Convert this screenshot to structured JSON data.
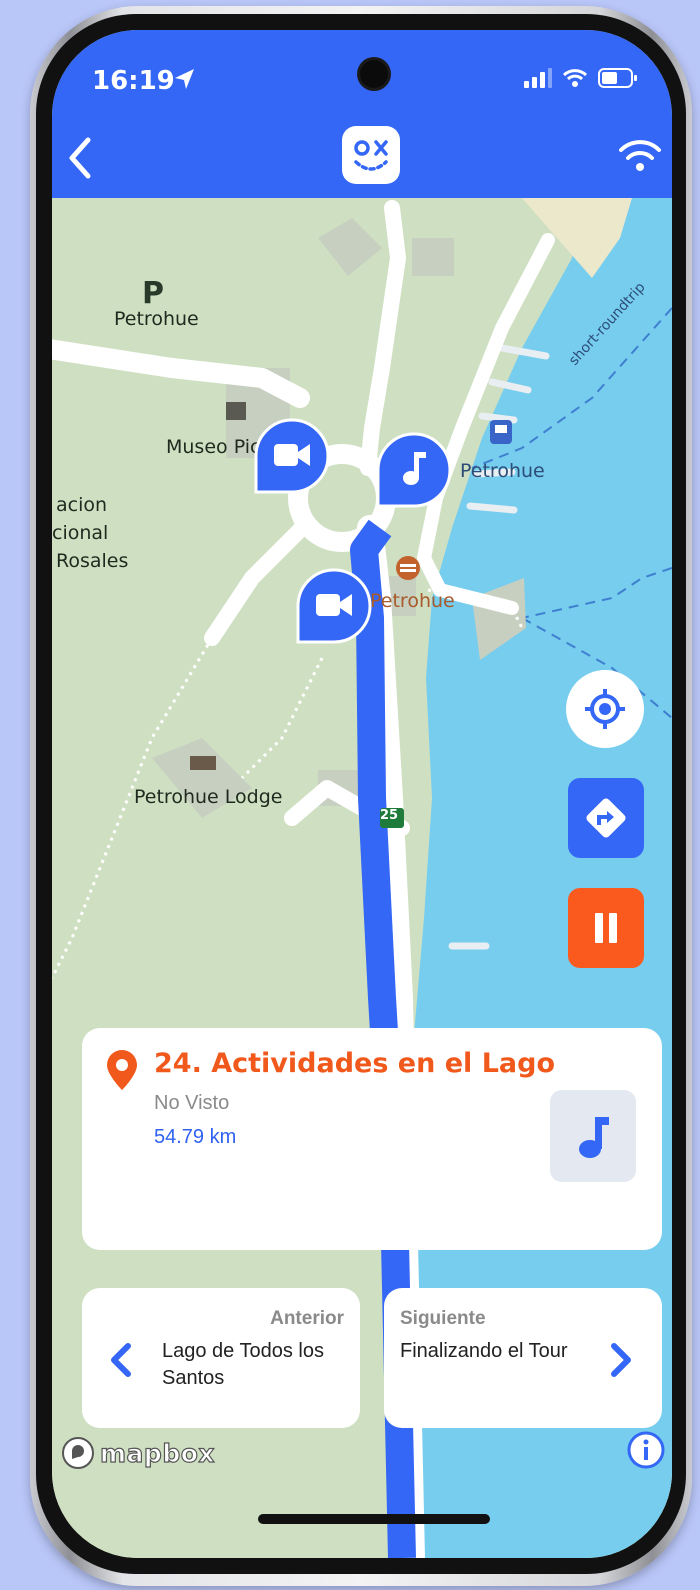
{
  "status_bar": {
    "time": "16:19"
  },
  "header": {
    "app_logo_label": "ox"
  },
  "map": {
    "labels": {
      "parking_letter": "P",
      "parking_name": "Petrohue",
      "museum": "Museo Pic",
      "park_line1": "acion",
      "park_line2": "cional",
      "park_line3": "Rosales",
      "ferry": "Petrohue",
      "restaurant": "Petrohue",
      "lodge": "Petrohue Lodge",
      "route_number": "25",
      "roundtrip": "short-roundtrip"
    }
  },
  "poi_card": {
    "title": "24. Actividades en el Lago",
    "status": "No Visto",
    "distance": "54.79 km"
  },
  "navigation": {
    "prev_heading": "Anterior",
    "prev_name": "Lago de Todos los Santos",
    "next_heading": "Siguiente",
    "next_name": "Finalizando el Tour"
  },
  "attribution": {
    "brand": "mapbox"
  },
  "colors": {
    "accent_blue": "#3467f5",
    "accent_orange": "#fa5a1e",
    "water": "#76cdee",
    "land": "#cfe0c2"
  }
}
